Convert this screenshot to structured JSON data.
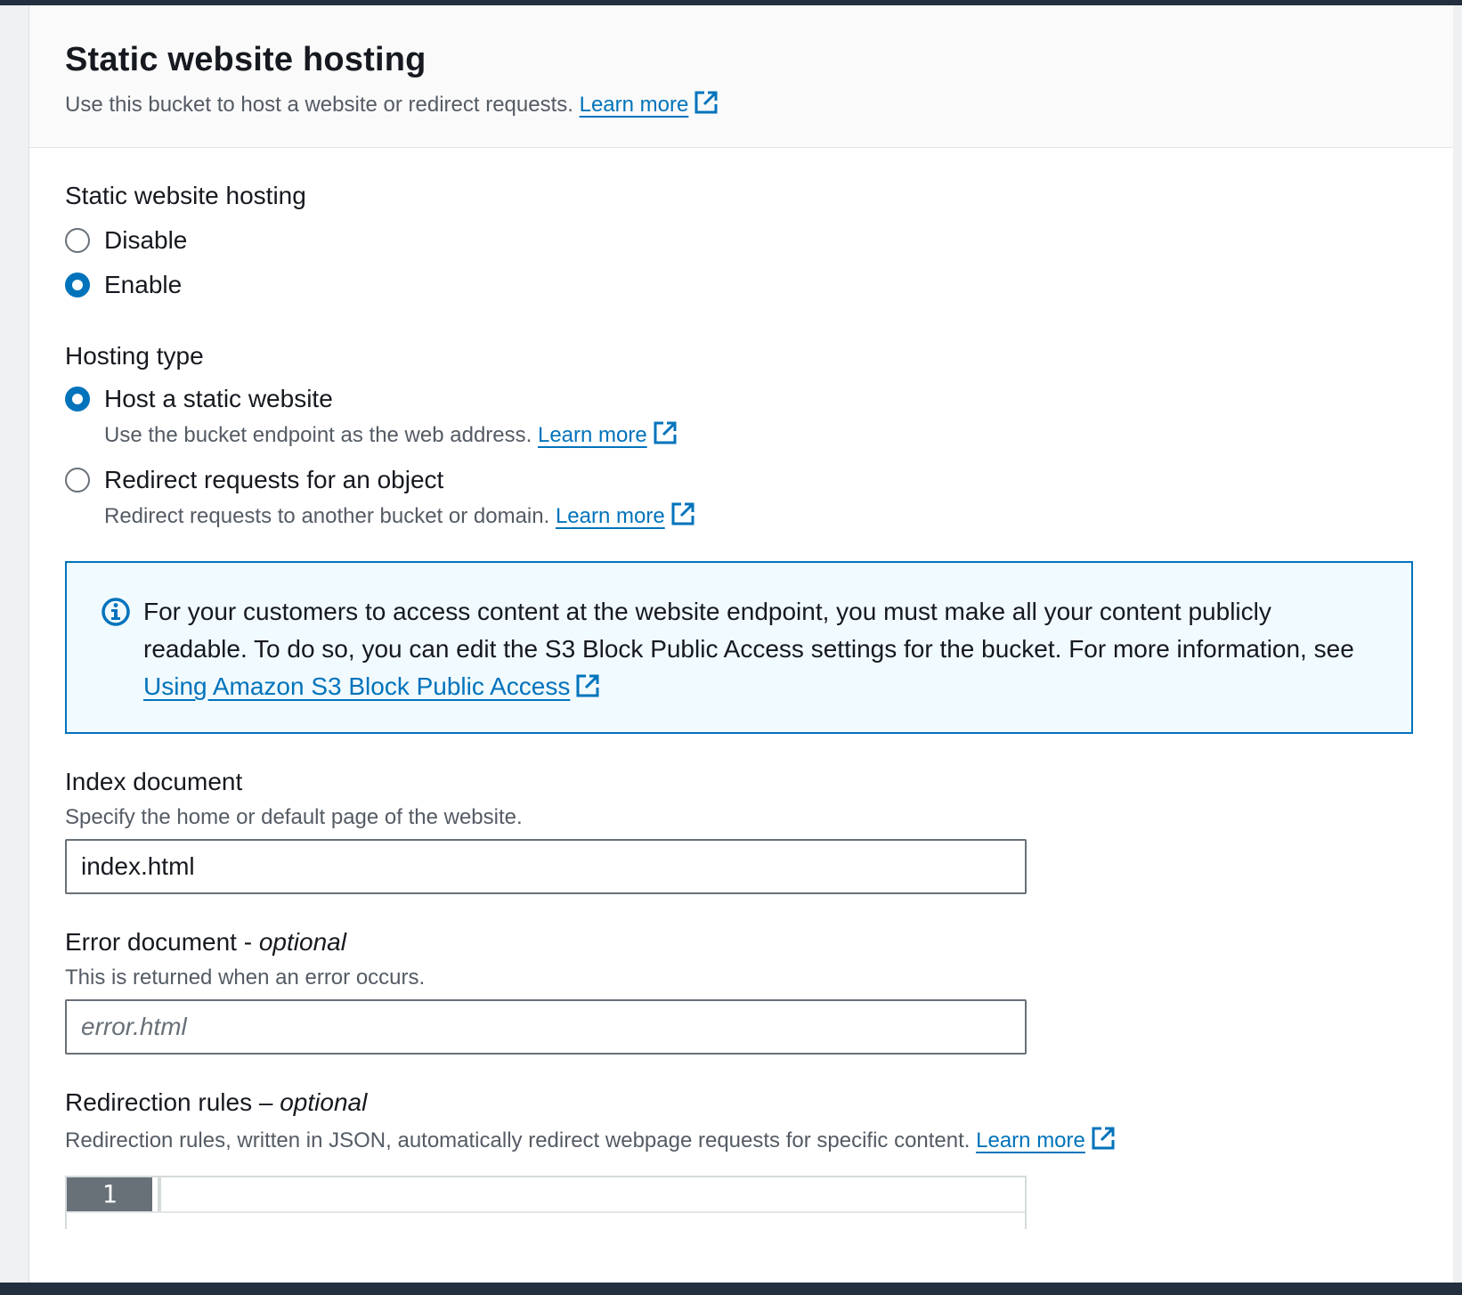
{
  "header": {
    "title": "Static website hosting",
    "description": "Use this bucket to host a website or redirect requests.",
    "learn_more": "Learn more"
  },
  "hosting_toggle": {
    "label": "Static website hosting",
    "options": [
      {
        "label": "Disable",
        "checked": false
      },
      {
        "label": "Enable",
        "checked": true
      }
    ]
  },
  "hosting_type": {
    "label": "Hosting type",
    "options": [
      {
        "label": "Host a static website",
        "description": "Use the bucket endpoint as the web address.",
        "learn_more": "Learn more",
        "checked": true
      },
      {
        "label": "Redirect requests for an object",
        "description": "Redirect requests to another bucket or domain.",
        "learn_more": "Learn more",
        "checked": false
      }
    ]
  },
  "alert": {
    "text": "For your customers to access content at the website endpoint, you must make all your content publicly readable. To do so, you can edit the S3 Block Public Access settings for the bucket. For more information, see",
    "link": "Using Amazon S3 Block Public Access",
    "icon": "info-icon"
  },
  "index_document": {
    "label": "Index document",
    "description": "Specify the home or default page of the website.",
    "value": "index.html"
  },
  "error_document": {
    "label": "Error document - ",
    "label_optional": "optional",
    "description": "This is returned when an error occurs.",
    "placeholder": "error.html",
    "value": ""
  },
  "redirection_rules": {
    "label": "Redirection rules – ",
    "label_optional": "optional",
    "description": "Redirection rules, written in JSON, automatically redirect webpage requests for specific content.",
    "learn_more": "Learn more",
    "line_number": "1"
  },
  "colors": {
    "accent": "#0073bb",
    "text": "#16191f",
    "secondary_text": "#545b64",
    "info_bg": "#f1faff",
    "frame": "#232f3e"
  }
}
